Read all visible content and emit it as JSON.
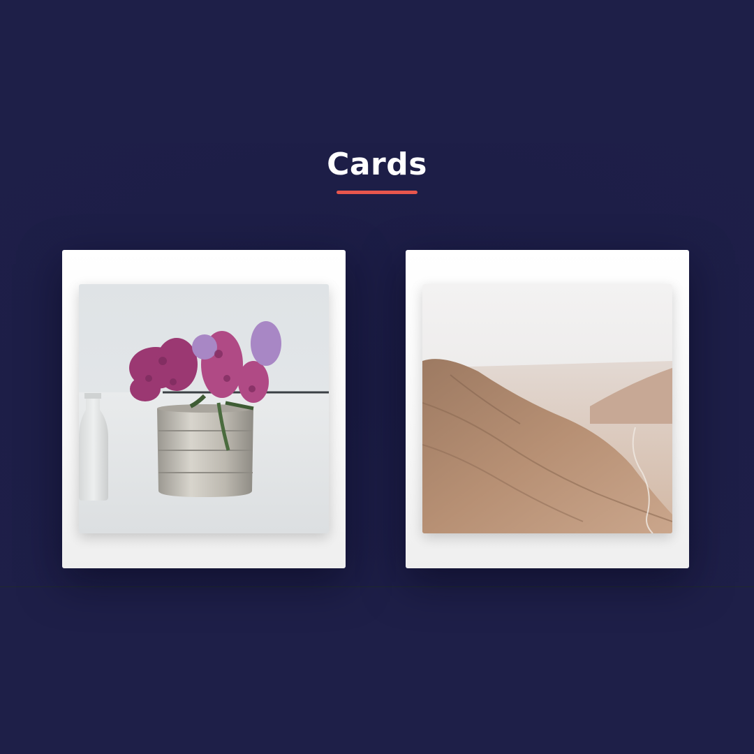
{
  "section": {
    "title": "Cards",
    "accent_color": "#e8564d",
    "background_color": "#1e1f48"
  },
  "cards": [
    {
      "image": "flower-bouquet-in-metal-cup-photo"
    },
    {
      "image": "desert-mountain-valley-photo"
    }
  ]
}
